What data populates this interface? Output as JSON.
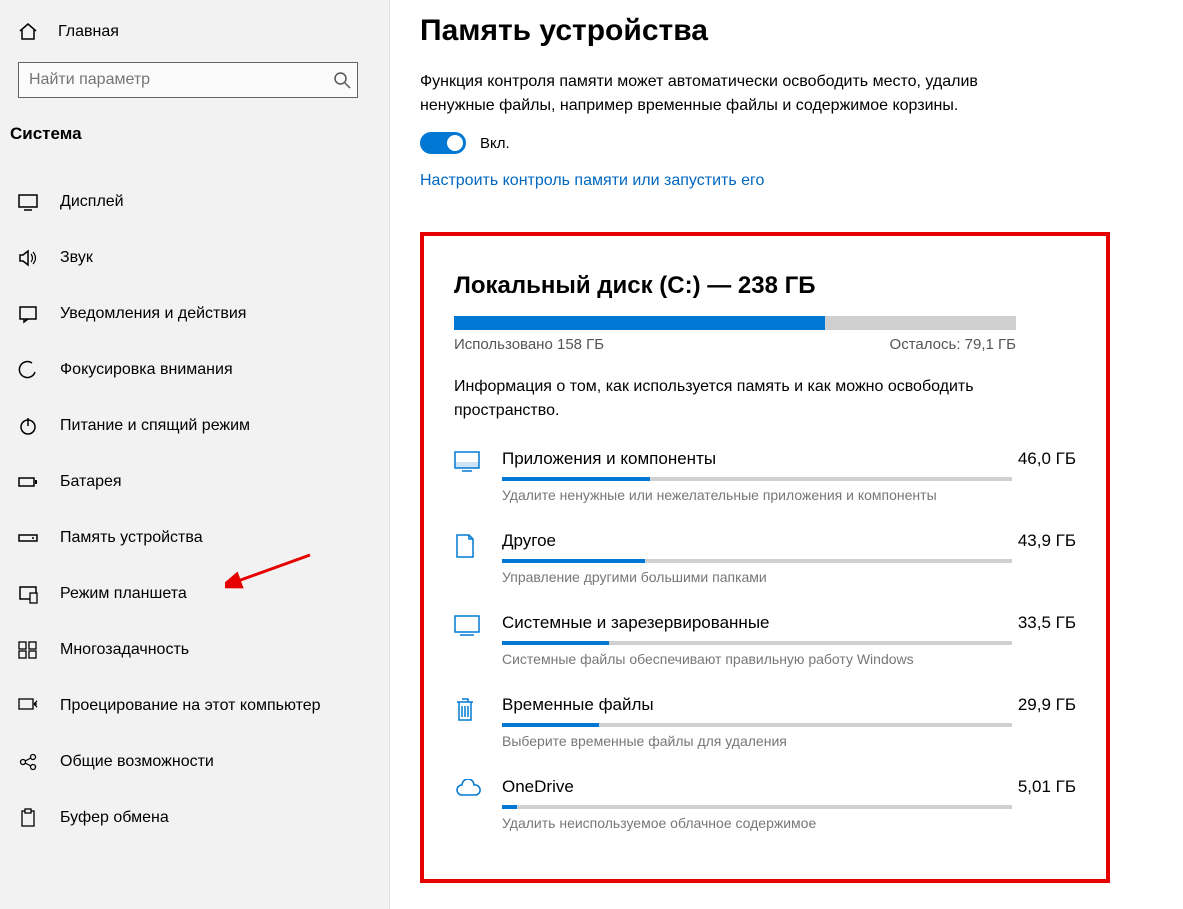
{
  "sidebar": {
    "home": "Главная",
    "search_placeholder": "Найти параметр",
    "section": "Система",
    "items": [
      {
        "label": "Дисплей",
        "icon": "display"
      },
      {
        "label": "Звук",
        "icon": "sound"
      },
      {
        "label": "Уведомления и действия",
        "icon": "notifications"
      },
      {
        "label": "Фокусировка внимания",
        "icon": "focus"
      },
      {
        "label": "Питание и спящий режим",
        "icon": "power"
      },
      {
        "label": "Батарея",
        "icon": "battery"
      },
      {
        "label": "Память устройства",
        "icon": "storage"
      },
      {
        "label": "Режим планшета",
        "icon": "tablet"
      },
      {
        "label": "Многозадачность",
        "icon": "multitask"
      },
      {
        "label": "Проецирование на этот компьютер",
        "icon": "project"
      },
      {
        "label": "Общие возможности",
        "icon": "shared"
      },
      {
        "label": "Буфер обмена",
        "icon": "clipboard"
      }
    ]
  },
  "main": {
    "title": "Память устройства",
    "description": "Функция контроля памяти может автоматически освободить место, удалив ненужные файлы, например временные файлы и содержимое корзины.",
    "toggle_label": "Вкл.",
    "toggle_on": true,
    "configure_link": "Настроить контроль памяти или запустить его",
    "disk": {
      "title": "Локальный диск (C:) — 238 ГБ",
      "used_label": "Использовано 158 ГБ",
      "free_label": "Осталось: 79,1 ГБ",
      "used_percent": 66,
      "info": "Информация о том, как используется память и как можно освободить пространство.",
      "categories": [
        {
          "name": "Приложения и компоненты",
          "size": "46,0 ГБ",
          "sub": "Удалите ненужные или нежелательные приложения и компоненты",
          "percent": 29,
          "icon": "apps"
        },
        {
          "name": "Другое",
          "size": "43,9 ГБ",
          "sub": "Управление другими большими папками",
          "percent": 28,
          "icon": "folder"
        },
        {
          "name": "Системные и зарезервированные",
          "size": "33,5 ГБ",
          "sub": "Системные файлы обеспечивают правильную работу Windows",
          "percent": 21,
          "icon": "system"
        },
        {
          "name": "Временные файлы",
          "size": "29,9 ГБ",
          "sub": "Выберите временные файлы для удаления",
          "percent": 19,
          "icon": "trash"
        },
        {
          "name": "OneDrive",
          "size": "5,01 ГБ",
          "sub": "Удалить неиспользуемое облачное содержимое",
          "percent": 3,
          "icon": "cloud"
        }
      ]
    }
  }
}
